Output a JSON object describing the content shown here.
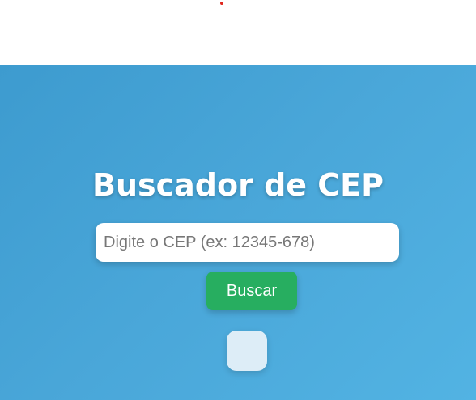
{
  "page": {
    "title": "Buscador de CEP"
  },
  "search": {
    "placeholder": "Digite o CEP (ex: 12345-678)",
    "value": "",
    "button_label": "Buscar"
  },
  "result": {
    "text": ""
  },
  "colors": {
    "accent": "#27ae60",
    "gradient_start": "#3d9bcf",
    "gradient_end": "#52b3e3"
  }
}
